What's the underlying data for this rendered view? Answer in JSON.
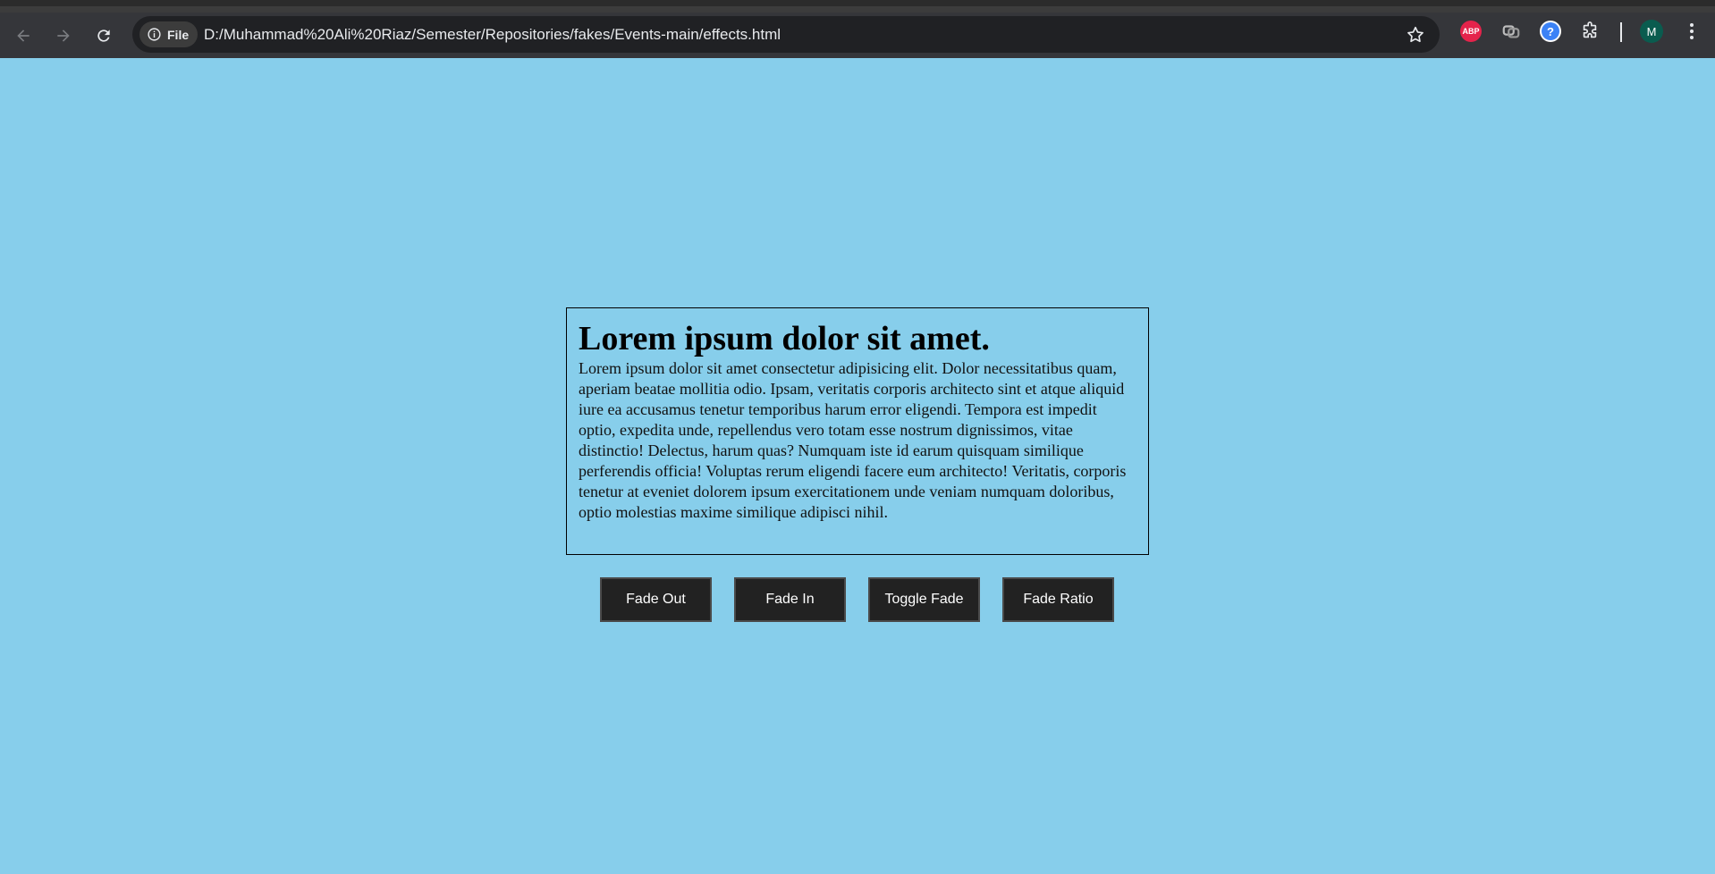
{
  "browser": {
    "chip_label": "File",
    "url": "D:/Muhammad%20Ali%20Riaz/Semester/Repositories/fakes/Events-main/effects.html",
    "abp_label": "ABP",
    "avatar_initial": "M"
  },
  "content": {
    "heading": "Lorem ipsum dolor sit amet.",
    "paragraph": "Lorem ipsum dolor sit amet consectetur adipisicing elit. Dolor necessitatibus quam, aperiam beatae mollitia odio. Ipsam, veritatis corporis architecto sint et atque aliquid iure ea accusamus tenetur temporibus harum error eligendi. Tempora est impedit optio, expedita unde, repellendus vero totam esse nostrum dignissimos, vitae distinctio! Delectus, harum quas? Numquam iste id earum quisquam similique perferendis officia! Voluptas rerum eligendi facere eum architecto! Veritatis, corporis tenetur at eveniet dolorem ipsum exercitationem unde veniam numquam doloribus, optio molestias maxime similique adipisci nihil."
  },
  "buttons": [
    {
      "label": "Fade Out"
    },
    {
      "label": "Fade In"
    },
    {
      "label": "Toggle Fade"
    },
    {
      "label": "Fade Ratio"
    }
  ],
  "colors": {
    "page_background": "#87ceeb",
    "button_background": "#222222",
    "chrome_background": "#35363a"
  }
}
